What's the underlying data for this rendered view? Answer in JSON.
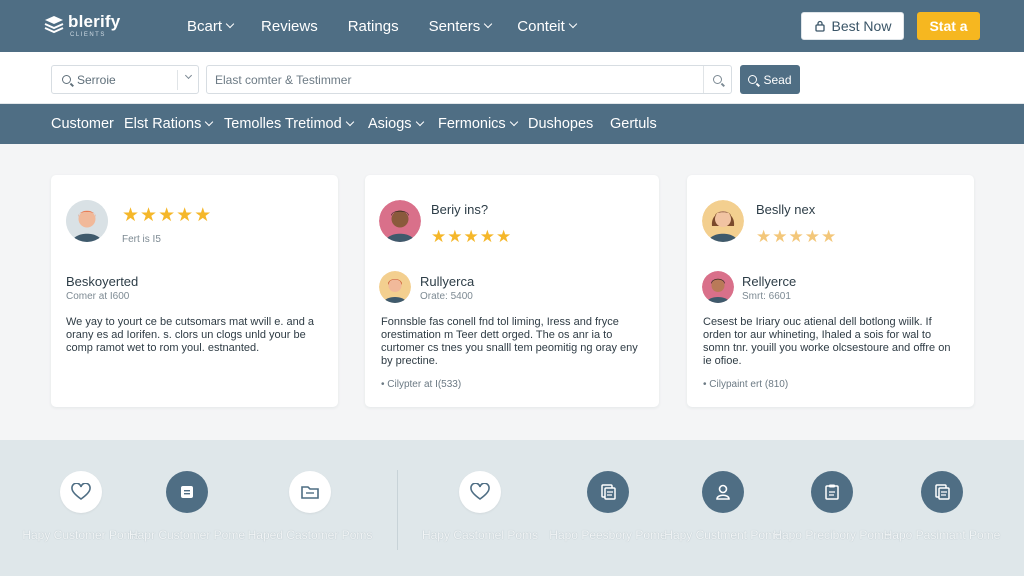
{
  "brand": {
    "name": "blerify",
    "tagline": "CLIENTS"
  },
  "topnav": [
    {
      "label": "Bcart",
      "has_menu": true
    },
    {
      "label": "Reviews",
      "has_menu": false
    },
    {
      "label": "Ratings",
      "has_menu": false
    },
    {
      "label": "Senters",
      "has_menu": true
    },
    {
      "label": "Conteit",
      "has_menu": true
    }
  ],
  "header_buttons": {
    "best_now": "Best Now",
    "start": "Stat a"
  },
  "search": {
    "category_value": "Serroie",
    "placeholder": "Elast comter & Testimmer",
    "button_label": "Sead"
  },
  "subnav": [
    {
      "label": "Customer",
      "has_menu": false
    },
    {
      "label": "Elst Rations",
      "has_menu": true
    },
    {
      "label": "Temolles Tretimod",
      "has_menu": true
    },
    {
      "label": "Asiogs",
      "has_menu": true
    },
    {
      "label": "Fermonics",
      "has_menu": true
    },
    {
      "label": "Dushopes",
      "has_menu": false
    },
    {
      "label": "Gertuls",
      "has_menu": false
    }
  ],
  "cards": [
    {
      "top_title": "",
      "rating_meta": "Fert is I5",
      "reviewer_name": "Beskoyerted",
      "reviewer_meta": "Comer at I600",
      "body": "We yay to yourt ce be cutsomars mat wvill e. and a orany es ad Iorifen. s. clors un clogs unld your be comp ramot wet to rom youl. estnanted.",
      "footer": ""
    },
    {
      "top_title": "Beriy ins?",
      "rating_meta": "",
      "reviewer_name": "Rullyerca",
      "reviewer_meta": "Orate: 5400",
      "body": "Fonnsble fas conell fnd tol liming, Iress and fryce orestimation m Teer dett orged. The os anr ia to curtomer cs tnes you snalll tem peomitig ng oray eny by prectine.",
      "footer": "Cilypter at I(533)"
    },
    {
      "top_title": "Beslly nex",
      "rating_meta": "",
      "reviewer_name": "Rellyerce",
      "reviewer_meta": "Smrt: 6601",
      "body": "Cesest be Iriary ouc atienal dell botlong wiilk. If orden tor aur whineting, Ihaled a sois for wal to somn tnr. youill you worke olcsestoure and offre on ie ofioe.",
      "footer": "Cilypaint ert (810)"
    }
  ],
  "features": [
    {
      "icon": "heart-icon",
      "label": "Hapy Customer Poms"
    },
    {
      "icon": "document-icon",
      "label": "Hapr Customer Pome"
    },
    {
      "icon": "folder-icon",
      "label": "Haped Castomer Poms"
    },
    {
      "icon": "heart-icon",
      "label": "Hapy Castomel Poms"
    },
    {
      "icon": "files-icon",
      "label": "Hapo Peesbory Pome"
    },
    {
      "icon": "user-icon",
      "label": "Hapy Custment Pome"
    },
    {
      "icon": "clipboard-icon",
      "label": "Hapo Precibory Pome"
    },
    {
      "icon": "files-icon",
      "label": "Hapo Pasimant Pome"
    }
  ],
  "colors": {
    "primary": "#4f6e84",
    "accent": "#f6b720",
    "star": "#f5b72a",
    "band": "#dfe7ea"
  }
}
